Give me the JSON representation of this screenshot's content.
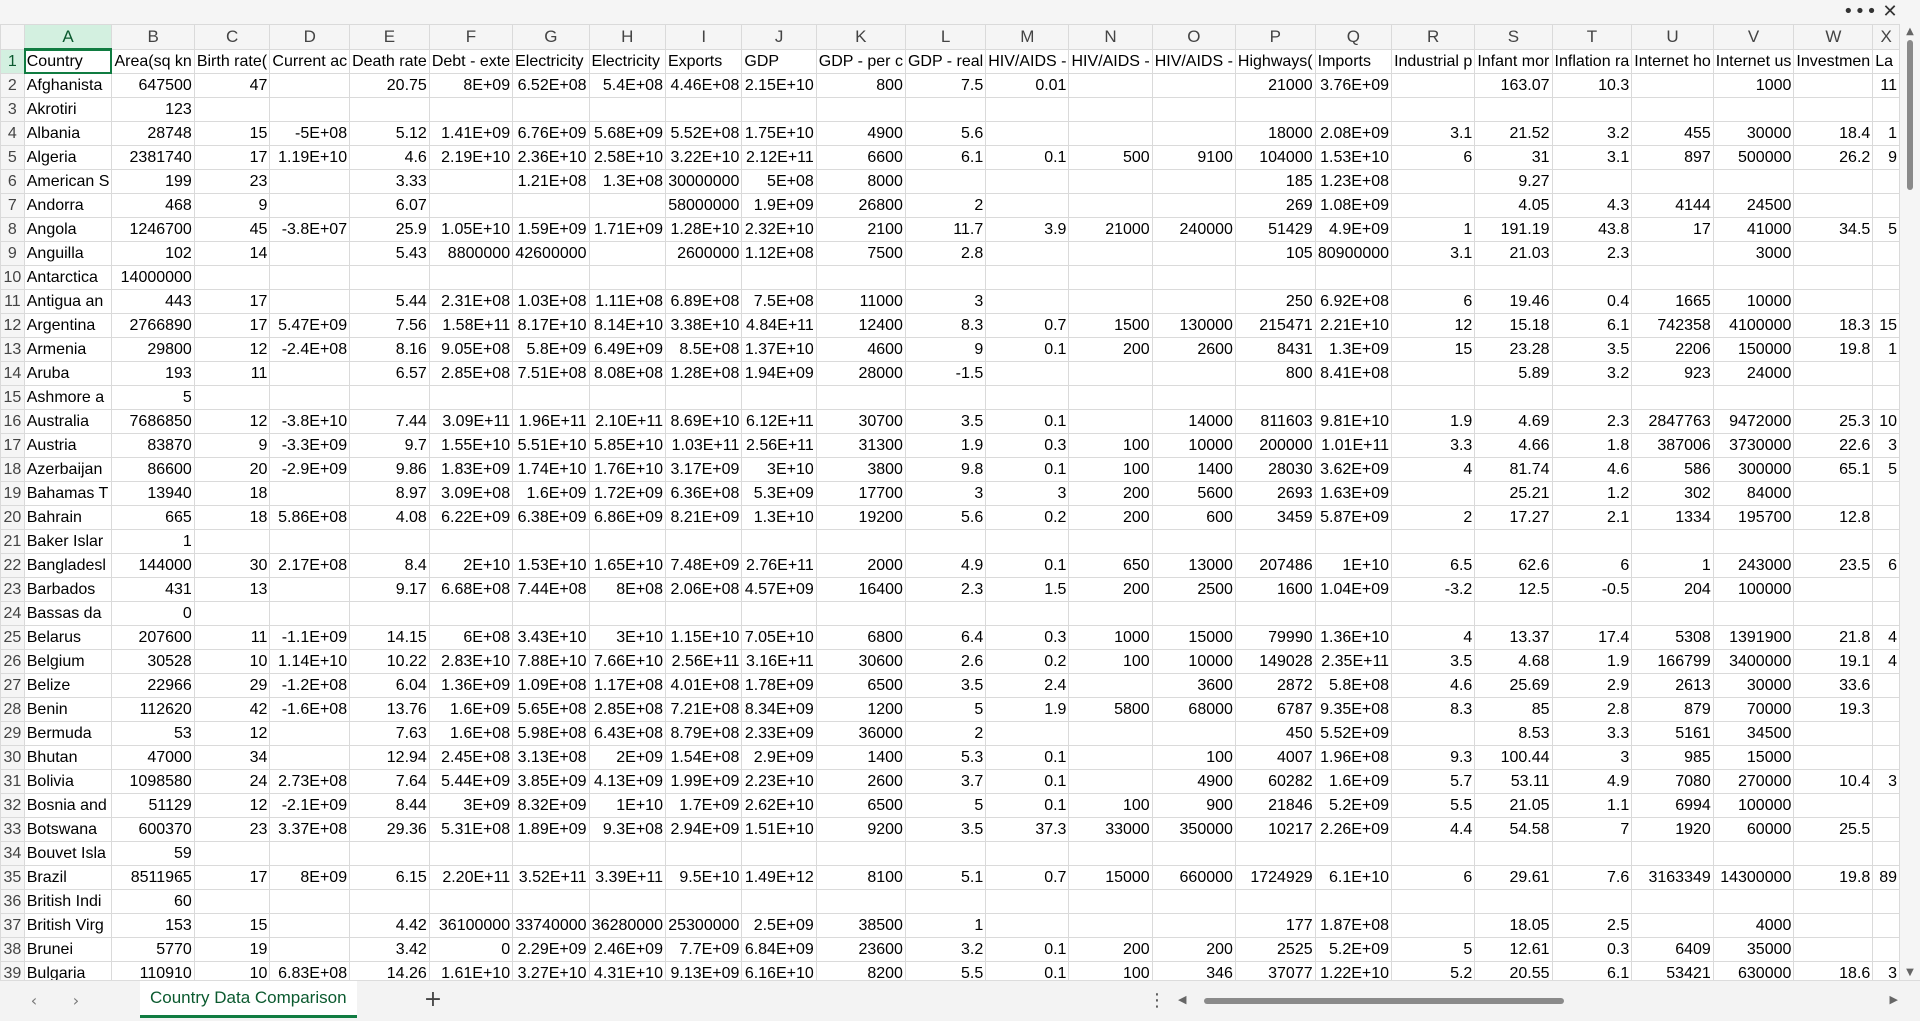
{
  "window": {
    "more_icon": "more-horizontal-icon",
    "close_icon": "close-icon"
  },
  "sheet": {
    "active_tab": "Country Data Comparison",
    "add_icon": "plus-icon",
    "menu_icon": "vertical-ellipsis-icon"
  },
  "selected_cell": "A1",
  "columns": [
    "A",
    "B",
    "C",
    "D",
    "E",
    "F",
    "G",
    "H",
    "I",
    "J",
    "K",
    "L",
    "M",
    "N",
    "O",
    "P",
    "Q",
    "R",
    "S",
    "T",
    "U",
    "V",
    "W",
    "X"
  ],
  "rows": [
    [
      "Country",
      "Area(sq kn",
      "Birth rate(",
      "Current ac",
      "Death rate",
      "Debt - exte",
      "Electricity",
      "Electricity",
      "Exports",
      "GDP",
      "GDP - per c",
      "GDP - real",
      "HIV/AIDS -",
      "HIV/AIDS -",
      "HIV/AIDS -",
      "Highways(",
      "Imports",
      "Industrial p",
      "Infant mor",
      "Inflation ra",
      "Internet ho",
      "Internet us",
      "Investmen",
      "La"
    ],
    [
      "Afghanista",
      "647500",
      "47",
      "",
      "20.75",
      "8E+09",
      "6.52E+08",
      "5.4E+08",
      "4.46E+08",
      "2.15E+10",
      "800",
      "7.5",
      "0.01",
      "",
      "",
      "21000",
      "3.76E+09",
      "",
      "163.07",
      "10.3",
      "",
      "1000",
      "",
      "11"
    ],
    [
      "Akrotiri",
      "123",
      "",
      "",
      "",
      "",
      "",
      "",
      "",
      "",
      "",
      "",
      "",
      "",
      "",
      "",
      "",
      "",
      "",
      "",
      "",
      "",
      "",
      ""
    ],
    [
      "Albania",
      "28748",
      "15",
      "-5E+08",
      "5.12",
      "1.41E+09",
      "6.76E+09",
      "5.68E+09",
      "5.52E+08",
      "1.75E+10",
      "4900",
      "5.6",
      "",
      "",
      "",
      "18000",
      "2.08E+09",
      "3.1",
      "21.52",
      "3.2",
      "455",
      "30000",
      "18.4",
      "1"
    ],
    [
      "Algeria",
      "2381740",
      "17",
      "1.19E+10",
      "4.6",
      "2.19E+10",
      "2.36E+10",
      "2.58E+10",
      "3.22E+10",
      "2.12E+11",
      "6600",
      "6.1",
      "0.1",
      "500",
      "9100",
      "104000",
      "1.53E+10",
      "6",
      "31",
      "3.1",
      "897",
      "500000",
      "26.2",
      "9"
    ],
    [
      "American S",
      "199",
      "23",
      "",
      "3.33",
      "",
      "1.21E+08",
      "1.3E+08",
      "30000000",
      "5E+08",
      "8000",
      "",
      "",
      "",
      "",
      "185",
      "1.23E+08",
      "",
      "9.27",
      "",
      "",
      "",
      "",
      ""
    ],
    [
      "Andorra",
      "468",
      "9",
      "",
      "6.07",
      "",
      "",
      "",
      "58000000",
      "1.9E+09",
      "26800",
      "2",
      "",
      "",
      "",
      "269",
      "1.08E+09",
      "",
      "4.05",
      "4.3",
      "4144",
      "24500",
      "",
      ""
    ],
    [
      "Angola",
      "1246700",
      "45",
      "-3.8E+07",
      "25.9",
      "1.05E+10",
      "1.59E+09",
      "1.71E+09",
      "1.28E+10",
      "2.32E+10",
      "2100",
      "11.7",
      "3.9",
      "21000",
      "240000",
      "51429",
      "4.9E+09",
      "1",
      "191.19",
      "43.8",
      "17",
      "41000",
      "34.5",
      "5"
    ],
    [
      "Anguilla",
      "102",
      "14",
      "",
      "5.43",
      "8800000",
      "42600000",
      "",
      "2600000",
      "1.12E+08",
      "7500",
      "2.8",
      "",
      "",
      "",
      "105",
      "80900000",
      "3.1",
      "21.03",
      "2.3",
      "",
      "3000",
      "",
      ""
    ],
    [
      "Antarctica",
      "14000000",
      "",
      "",
      "",
      "",
      "",
      "",
      "",
      "",
      "",
      "",
      "",
      "",
      "",
      "",
      "",
      "",
      "",
      "",
      "",
      "",
      "",
      ""
    ],
    [
      "Antigua an",
      "443",
      "17",
      "",
      "5.44",
      "2.31E+08",
      "1.03E+08",
      "1.11E+08",
      "6.89E+08",
      "7.5E+08",
      "11000",
      "3",
      "",
      "",
      "",
      "250",
      "6.92E+08",
      "6",
      "19.46",
      "0.4",
      "1665",
      "10000",
      "",
      ""
    ],
    [
      "Argentina",
      "2766890",
      "17",
      "5.47E+09",
      "7.56",
      "1.58E+11",
      "8.17E+10",
      "8.14E+10",
      "3.38E+10",
      "4.84E+11",
      "12400",
      "8.3",
      "0.7",
      "1500",
      "130000",
      "215471",
      "2.21E+10",
      "12",
      "15.18",
      "6.1",
      "742358",
      "4100000",
      "18.3",
      "15"
    ],
    [
      "Armenia",
      "29800",
      "12",
      "-2.4E+08",
      "8.16",
      "9.05E+08",
      "5.8E+09",
      "6.49E+09",
      "8.5E+08",
      "1.37E+10",
      "4600",
      "9",
      "0.1",
      "200",
      "2600",
      "8431",
      "1.3E+09",
      "15",
      "23.28",
      "3.5",
      "2206",
      "150000",
      "19.8",
      "1"
    ],
    [
      "Aruba",
      "193",
      "11",
      "",
      "6.57",
      "2.85E+08",
      "7.51E+08",
      "8.08E+08",
      "1.28E+08",
      "1.94E+09",
      "28000",
      "-1.5",
      "",
      "",
      "",
      "800",
      "8.41E+08",
      "",
      "5.89",
      "3.2",
      "923",
      "24000",
      "",
      ""
    ],
    [
      "Ashmore a",
      "5",
      "",
      "",
      "",
      "",
      "",
      "",
      "",
      "",
      "",
      "",
      "",
      "",
      "",
      "",
      "",
      "",
      "",
      "",
      "",
      "",
      "",
      ""
    ],
    [
      "Australia",
      "7686850",
      "12",
      "-3.8E+10",
      "7.44",
      "3.09E+11",
      "1.96E+11",
      "2.10E+11",
      "8.69E+10",
      "6.12E+11",
      "30700",
      "3.5",
      "0.1",
      "",
      "14000",
      "811603",
      "9.81E+10",
      "1.9",
      "4.69",
      "2.3",
      "2847763",
      "9472000",
      "25.3",
      "10"
    ],
    [
      "Austria",
      "83870",
      "9",
      "-3.3E+09",
      "9.7",
      "1.55E+10",
      "5.51E+10",
      "5.85E+10",
      "1.03E+11",
      "2.56E+11",
      "31300",
      "1.9",
      "0.3",
      "100",
      "10000",
      "200000",
      "1.01E+11",
      "3.3",
      "4.66",
      "1.8",
      "387006",
      "3730000",
      "22.6",
      "3"
    ],
    [
      "Azerbaijan",
      "86600",
      "20",
      "-2.9E+09",
      "9.86",
      "1.83E+09",
      "1.74E+10",
      "1.76E+10",
      "3.17E+09",
      "3E+10",
      "3800",
      "9.8",
      "0.1",
      "100",
      "1400",
      "28030",
      "3.62E+09",
      "4",
      "81.74",
      "4.6",
      "586",
      "300000",
      "65.1",
      "5"
    ],
    [
      "Bahamas T",
      "13940",
      "18",
      "",
      "8.97",
      "3.09E+08",
      "1.6E+09",
      "1.72E+09",
      "6.36E+08",
      "5.3E+09",
      "17700",
      "3",
      "3",
      "200",
      "5600",
      "2693",
      "1.63E+09",
      "",
      "25.21",
      "1.2",
      "302",
      "84000",
      "",
      ""
    ],
    [
      "Bahrain",
      "665",
      "18",
      "5.86E+08",
      "4.08",
      "6.22E+09",
      "6.38E+09",
      "6.86E+09",
      "8.21E+09",
      "1.3E+10",
      "19200",
      "5.6",
      "0.2",
      "200",
      "600",
      "3459",
      "5.87E+09",
      "2",
      "17.27",
      "2.1",
      "1334",
      "195700",
      "12.8",
      ""
    ],
    [
      "Baker Islar",
      "1",
      "",
      "",
      "",
      "",
      "",
      "",
      "",
      "",
      "",
      "",
      "",
      "",
      "",
      "",
      "",
      "",
      "",
      "",
      "",
      "",
      "",
      ""
    ],
    [
      "Bangladesl",
      "144000",
      "30",
      "2.17E+08",
      "8.4",
      "2E+10",
      "1.53E+10",
      "1.65E+10",
      "7.48E+09",
      "2.76E+11",
      "2000",
      "4.9",
      "0.1",
      "650",
      "13000",
      "207486",
      "1E+10",
      "6.5",
      "62.6",
      "6",
      "1",
      "243000",
      "23.5",
      "6"
    ],
    [
      "Barbados",
      "431",
      "13",
      "",
      "9.17",
      "6.68E+08",
      "7.44E+08",
      "8E+08",
      "2.06E+08",
      "4.57E+09",
      "16400",
      "2.3",
      "1.5",
      "200",
      "2500",
      "1600",
      "1.04E+09",
      "-3.2",
      "12.5",
      "-0.5",
      "204",
      "100000",
      "",
      ""
    ],
    [
      "Bassas da",
      "0",
      "",
      "",
      "",
      "",
      "",
      "",
      "",
      "",
      "",
      "",
      "",
      "",
      "",
      "",
      "",
      "",
      "",
      "",
      "",
      "",
      "",
      ""
    ],
    [
      "Belarus",
      "207600",
      "11",
      "-1.1E+09",
      "14.15",
      "6E+08",
      "3.43E+10",
      "3E+10",
      "1.15E+10",
      "7.05E+10",
      "6800",
      "6.4",
      "0.3",
      "1000",
      "15000",
      "79990",
      "1.36E+10",
      "4",
      "13.37",
      "17.4",
      "5308",
      "1391900",
      "21.8",
      "4"
    ],
    [
      "Belgium",
      "30528",
      "10",
      "1.14E+10",
      "10.22",
      "2.83E+10",
      "7.88E+10",
      "7.66E+10",
      "2.56E+11",
      "3.16E+11",
      "30600",
      "2.6",
      "0.2",
      "100",
      "10000",
      "149028",
      "2.35E+11",
      "3.5",
      "4.68",
      "1.9",
      "166799",
      "3400000",
      "19.1",
      "4"
    ],
    [
      "Belize",
      "22966",
      "29",
      "-1.2E+08",
      "6.04",
      "1.36E+09",
      "1.09E+08",
      "1.17E+08",
      "4.01E+08",
      "1.78E+09",
      "6500",
      "3.5",
      "2.4",
      "",
      "3600",
      "2872",
      "5.8E+08",
      "4.6",
      "25.69",
      "2.9",
      "2613",
      "30000",
      "33.6",
      ""
    ],
    [
      "Benin",
      "112620",
      "42",
      "-1.6E+08",
      "13.76",
      "1.6E+09",
      "5.65E+08",
      "2.85E+08",
      "7.21E+08",
      "8.34E+09",
      "1200",
      "5",
      "1.9",
      "5800",
      "68000",
      "6787",
      "9.35E+08",
      "8.3",
      "85",
      "2.8",
      "879",
      "70000",
      "19.3",
      ""
    ],
    [
      "Bermuda",
      "53",
      "12",
      "",
      "7.63",
      "1.6E+08",
      "5.98E+08",
      "6.43E+08",
      "8.79E+08",
      "2.33E+09",
      "36000",
      "2",
      "",
      "",
      "",
      "450",
      "5.52E+09",
      "",
      "8.53",
      "3.3",
      "5161",
      "34500",
      "",
      ""
    ],
    [
      "Bhutan",
      "47000",
      "34",
      "",
      "12.94",
      "2.45E+08",
      "3.13E+08",
      "2E+09",
      "1.54E+08",
      "2.9E+09",
      "1400",
      "5.3",
      "0.1",
      "",
      "100",
      "4007",
      "1.96E+08",
      "9.3",
      "100.44",
      "3",
      "985",
      "15000",
      "",
      ""
    ],
    [
      "Bolivia",
      "1098580",
      "24",
      "2.73E+08",
      "7.64",
      "5.44E+09",
      "3.85E+09",
      "4.13E+09",
      "1.99E+09",
      "2.23E+10",
      "2600",
      "3.7",
      "0.1",
      "",
      "4900",
      "60282",
      "1.6E+09",
      "5.7",
      "53.11",
      "4.9",
      "7080",
      "270000",
      "10.4",
      "3"
    ],
    [
      "Bosnia and",
      "51129",
      "12",
      "-2.1E+09",
      "8.44",
      "3E+09",
      "8.32E+09",
      "1E+10",
      "1.7E+09",
      "2.62E+10",
      "6500",
      "5",
      "0.1",
      "100",
      "900",
      "21846",
      "5.2E+09",
      "5.5",
      "21.05",
      "1.1",
      "6994",
      "100000",
      "",
      ""
    ],
    [
      "Botswana",
      "600370",
      "23",
      "3.37E+08",
      "29.36",
      "5.31E+08",
      "1.89E+09",
      "9.3E+08",
      "2.94E+09",
      "1.51E+10",
      "9200",
      "3.5",
      "37.3",
      "33000",
      "350000",
      "10217",
      "2.26E+09",
      "4.4",
      "54.58",
      "7",
      "1920",
      "60000",
      "25.5",
      ""
    ],
    [
      "Bouvet Isla",
      "59",
      "",
      "",
      "",
      "",
      "",
      "",
      "",
      "",
      "",
      "",
      "",
      "",
      "",
      "",
      "",
      "",
      "",
      "",
      "",
      "",
      "",
      ""
    ],
    [
      "Brazil",
      "8511965",
      "17",
      "8E+09",
      "6.15",
      "2.20E+11",
      "3.52E+11",
      "3.39E+11",
      "9.5E+10",
      "1.49E+12",
      "8100",
      "5.1",
      "0.7",
      "15000",
      "660000",
      "1724929",
      "6.1E+10",
      "6",
      "29.61",
      "7.6",
      "3163349",
      "14300000",
      "19.8",
      "89"
    ],
    [
      "British Indi",
      "60",
      "",
      "",
      "",
      "",
      "",
      "",
      "",
      "",
      "",
      "",
      "",
      "",
      "",
      "",
      "",
      "",
      "",
      "",
      "",
      "",
      "",
      ""
    ],
    [
      "British Virg",
      "153",
      "15",
      "",
      "4.42",
      "36100000",
      "33740000",
      "36280000",
      "25300000",
      "2.5E+09",
      "38500",
      "1",
      "",
      "",
      "",
      "177",
      "1.87E+08",
      "",
      "18.05",
      "2.5",
      "",
      "4000",
      "",
      ""
    ],
    [
      "Brunei",
      "5770",
      "19",
      "",
      "3.42",
      "0",
      "2.29E+09",
      "2.46E+09",
      "7.7E+09",
      "6.84E+09",
      "23600",
      "3.2",
      "0.1",
      "200",
      "200",
      "2525",
      "5.2E+09",
      "5",
      "12.61",
      "0.3",
      "6409",
      "35000",
      "",
      ""
    ],
    [
      "Bulgaria",
      "110910",
      "10",
      "6.83E+08",
      "14.26",
      "1.61E+10",
      "3.27E+10",
      "4.31E+10",
      "9.13E+09",
      "6.16E+10",
      "8200",
      "5.5",
      "0.1",
      "100",
      "346",
      "37077",
      "1.22E+10",
      "5.2",
      "20.55",
      "6.1",
      "53421",
      "630000",
      "18.6",
      "3"
    ]
  ]
}
